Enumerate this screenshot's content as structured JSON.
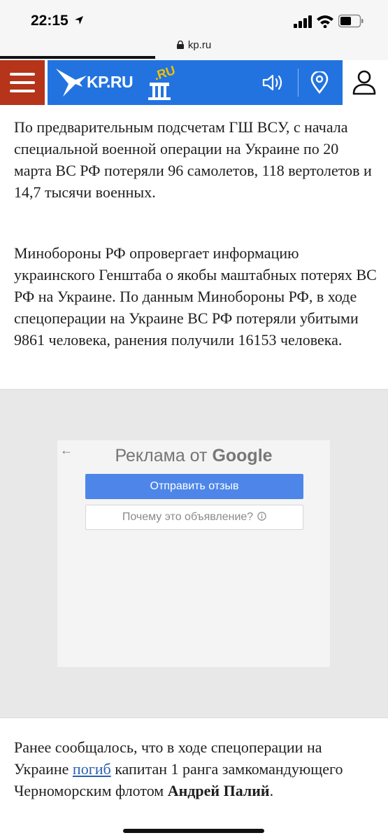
{
  "status": {
    "time": "22:15"
  },
  "browser": {
    "url": "kp.ru"
  },
  "header": {
    "logo_text": "KP.RU"
  },
  "article": {
    "paragraph1": "По предварительным подсчетам ГШ ВСУ, с начала специальной военной операции на Украине по 20 марта ВС РФ потеряли 96 самолетов, 118 вертолетов и 14,7 тысячи военных.",
    "paragraph2": "Минобороны РФ опровергает информацию украинского Генштаба о якобы маштабных потерях ВС РФ на Украине. По данным Минобороны РФ, в ходе спецоперации на Украине ВС РФ потеряли убитыми 9861 человека, ранения получили 16153 человека.",
    "paragraph3_before": "Ранее сообщалось, что в ходе спецоперации на Украине ",
    "paragraph3_link": "погиб",
    "paragraph3_middle": " капитан 1 ранга замкомандующего Черноморским флотом ",
    "paragraph3_bold": "Андрей Палий",
    "paragraph3_end": "."
  },
  "ad": {
    "back_arrow": "←",
    "title_prefix": "Реклама от ",
    "title_brand": "Google",
    "send_feedback": "Отправить отзыв",
    "why_this_ad": "Почему это объявление?"
  },
  "colors": {
    "menu": "#b5341a",
    "brand": "#2273e0",
    "ad_button": "#4d86e8",
    "link": "#2a5db0"
  }
}
